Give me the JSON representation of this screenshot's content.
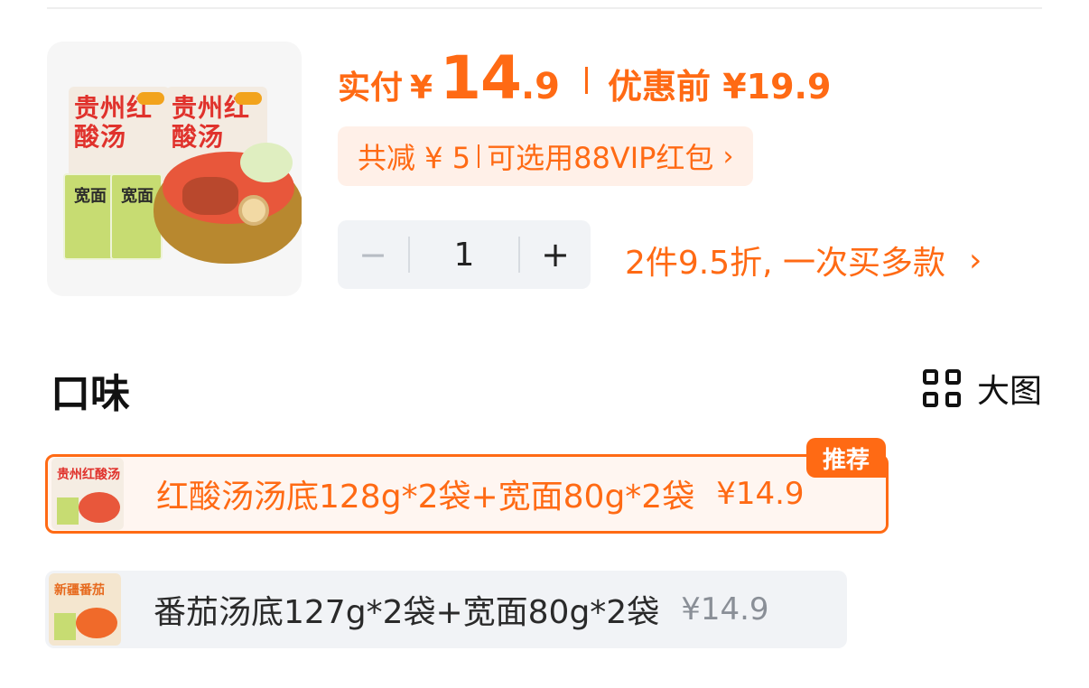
{
  "product": {
    "thumb_title": "贵州红酸汤",
    "noodle_label": "宽面"
  },
  "price": {
    "pay_label": "实付",
    "currency": "¥",
    "pay_int": "14",
    "pay_dec": ".9",
    "original": "优惠前 ¥19.9"
  },
  "discount": {
    "saved": "共减 ¥ 5",
    "vip": "可选用88VIP红包",
    "chevron": "›"
  },
  "quantity": {
    "minus": "−",
    "value": "1",
    "plus": "+"
  },
  "multi_offer": {
    "text": "2件9.5折, 一次买多款",
    "chevron": "›"
  },
  "flavor": {
    "title": "口味",
    "big_image_label": "大图"
  },
  "options": [
    {
      "label": "红酸汤汤底128g*2袋+宽面80g*2袋",
      "price": "¥14.9",
      "badge": "推荐",
      "thumb_text": "贵州红酸汤"
    },
    {
      "label": "番茄汤底127g*2袋+宽面80g*2袋",
      "price": "¥14.9",
      "thumb_text": "新疆番茄"
    }
  ],
  "colors": {
    "accent": "#ff6a14",
    "accent_bg": "#fff0e8",
    "neutral_bg": "#f1f3f6"
  },
  "icons": [
    "grid-icon",
    "chevron-right-icon"
  ]
}
